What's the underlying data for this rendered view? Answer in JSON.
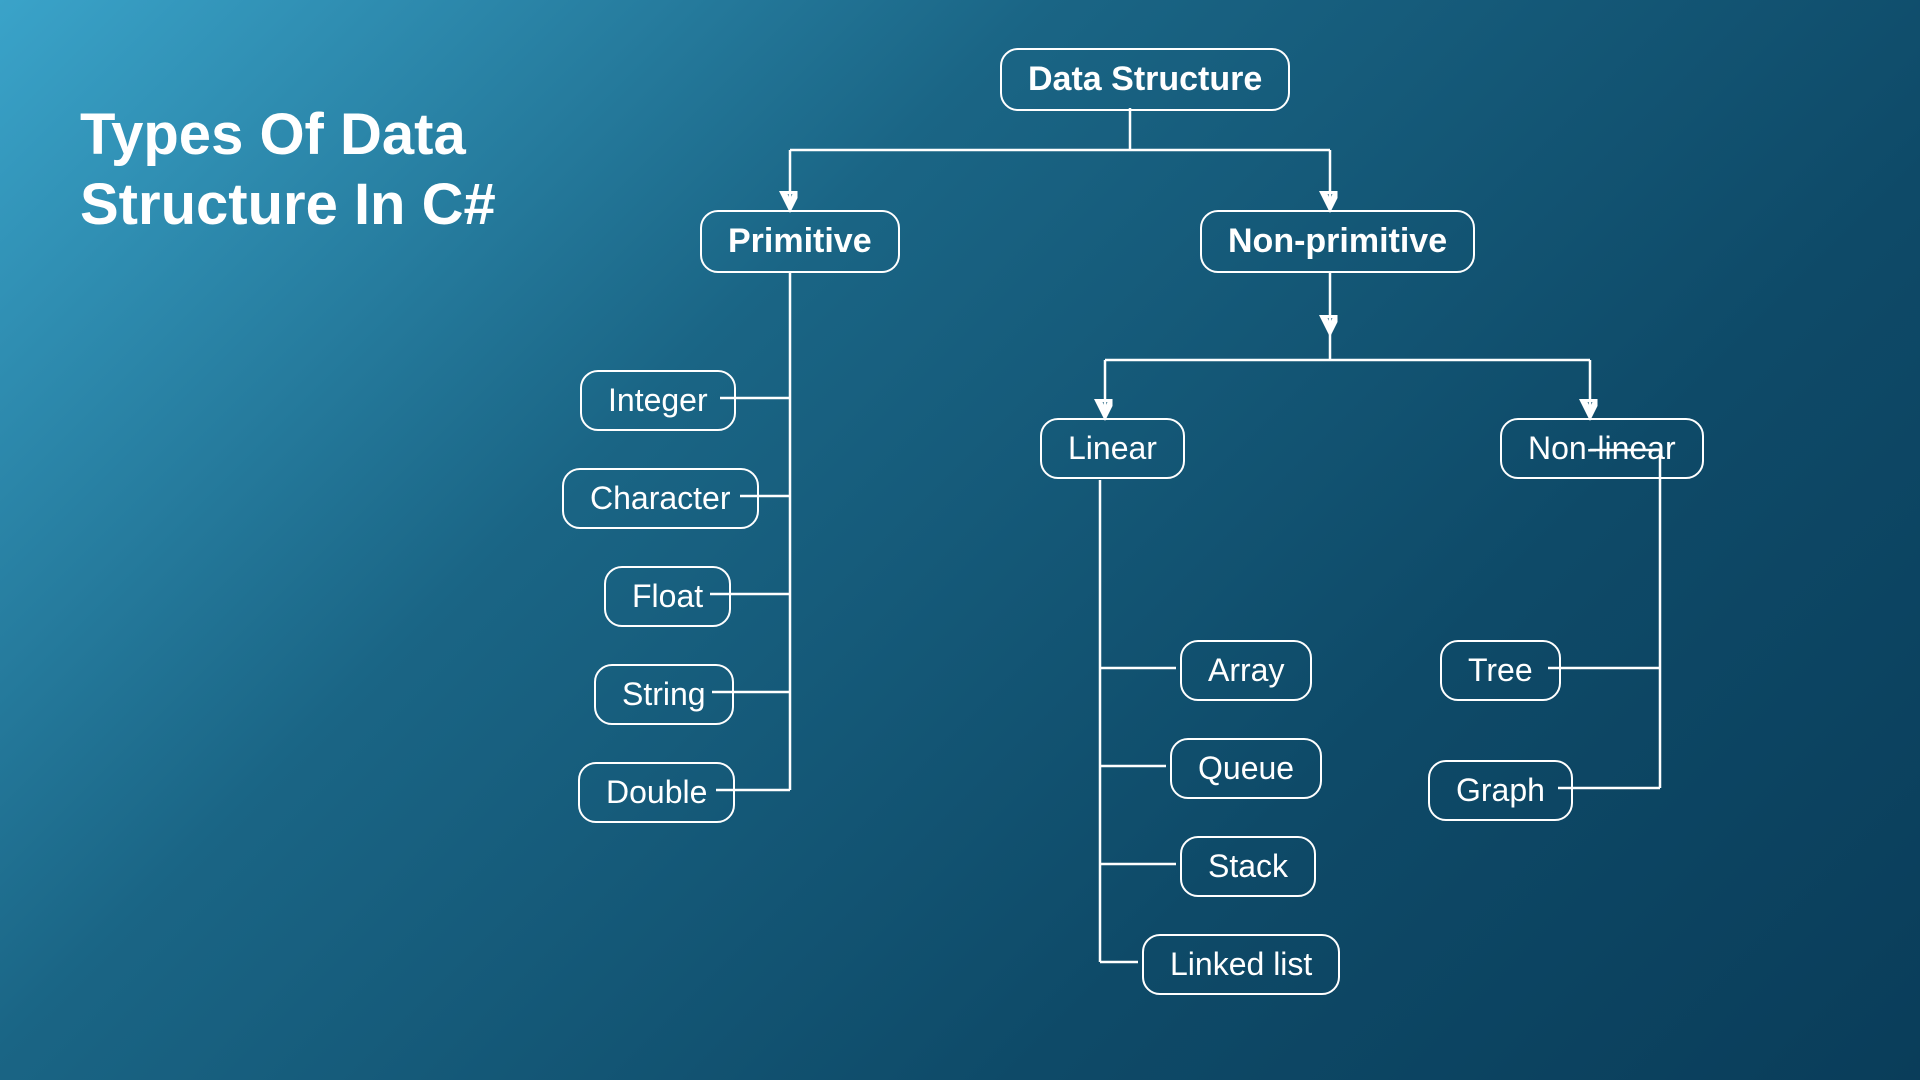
{
  "title_line1": "Types Of Data",
  "title_line2": "Structure In C#",
  "root": "Data Structure",
  "primitive": {
    "label": "Primitive",
    "children": [
      "Integer",
      "Character",
      "Float",
      "String",
      "Double"
    ]
  },
  "nonprimitive": {
    "label": "Non-primitive",
    "linear": {
      "label": "Linear",
      "children": [
        "Array",
        "Queue",
        "Stack",
        "Linked list"
      ]
    },
    "nonlinear": {
      "label": "Non-linear",
      "children": [
        "Tree",
        "Graph"
      ]
    }
  }
}
